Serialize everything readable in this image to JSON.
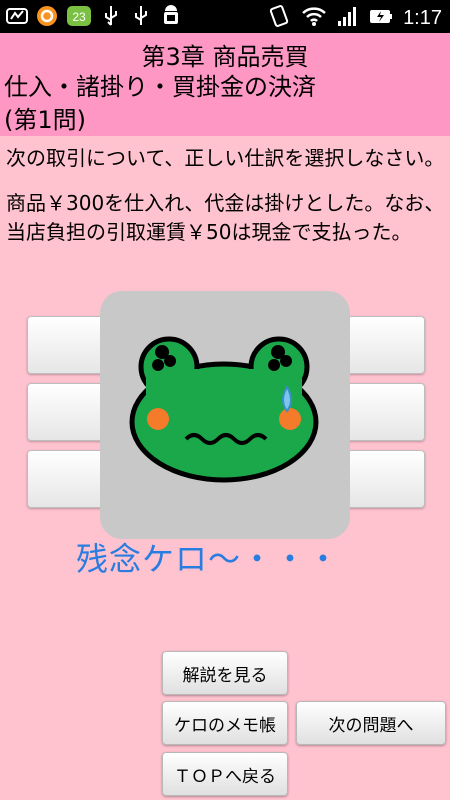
{
  "status_bar": {
    "notification_count": "23",
    "time": "1:17",
    "left_icons": [
      "notification-icon",
      "app-icon",
      "badge-icon",
      "usb-icon",
      "usb-icon",
      "android-debug-icon"
    ],
    "right_icons": [
      "rotation-icon",
      "wifi-icon",
      "signal-icon",
      "battery-icon"
    ]
  },
  "header": {
    "chapter": "第3章 商品売買",
    "section_line1": "仕入・諸掛り・買掛金の決済",
    "section_line2": "(第1問)"
  },
  "question": {
    "intro": "次の取引について、正しい仕訳を選択しなさい。",
    "body": "商品￥300を仕入れ、代金は掛けとした。なお、当店負担の引取運賃￥50は現金で支払った。"
  },
  "popup": {
    "image": "sad-frog-icon",
    "message": "残念ケロ～・・・"
  },
  "buttons": {
    "explanation": "解説を見る",
    "memo": "ケロのメモ帳",
    "next": "次の問題へ",
    "top": "ＴＯＰへ戻る"
  },
  "colors": {
    "background": "#ffc2cf",
    "header": "#ff97c4",
    "result_text": "#2a7de0",
    "frog": "#1aa84a"
  }
}
